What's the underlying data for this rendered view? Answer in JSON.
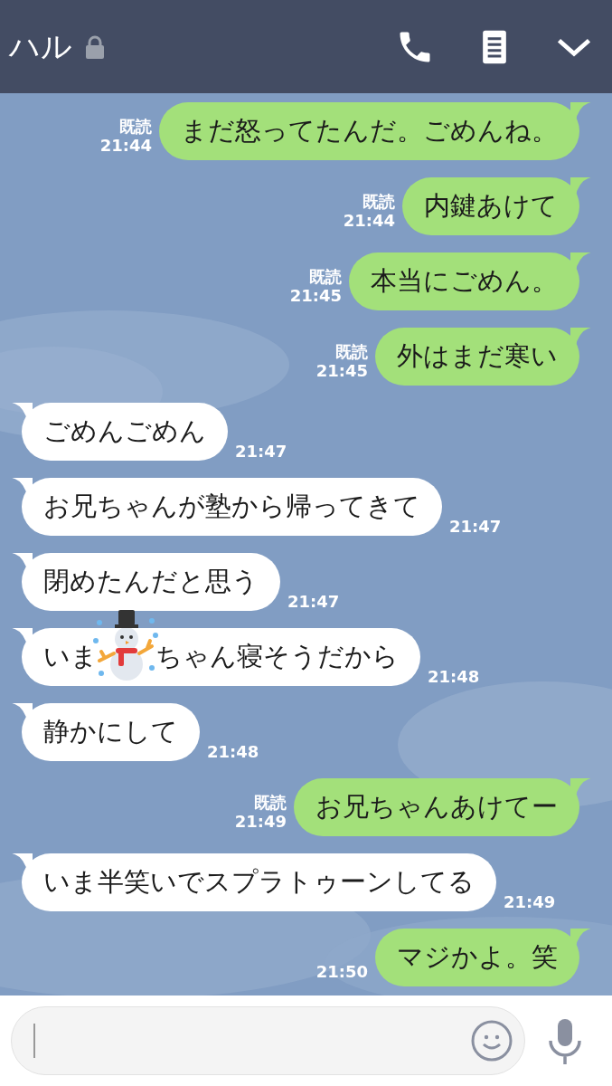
{
  "header": {
    "title": "ハル",
    "locked": true
  },
  "messages": [
    {
      "kind": "sent",
      "text": "まだ怒ってたんだ。ごめんね。",
      "read_receipt": "既読",
      "time": "21:44"
    },
    {
      "kind": "sent",
      "text": "内鍵あけて",
      "read_receipt": "既読",
      "time": "21:44"
    },
    {
      "kind": "sent",
      "text": "本当にごめん。",
      "read_receipt": "既読",
      "time": "21:45"
    },
    {
      "kind": "sent",
      "text": "外はまだ寒い",
      "read_receipt": "既読",
      "time": "21:45"
    },
    {
      "kind": "received",
      "text": "ごめんごめん",
      "time": "21:47"
    },
    {
      "kind": "received",
      "text": "お兄ちゃんが塾から帰ってきて",
      "time": "21:47"
    },
    {
      "kind": "received",
      "text": "閉めたんだと思う",
      "time": "21:47"
    },
    {
      "kind": "received",
      "text": "いま",
      "text_after": "ちゃん寝そうだから",
      "sticker": {
        "kind": "snowman"
      },
      "time": "21:48"
    },
    {
      "kind": "received",
      "text": "静かにして",
      "time": "21:48"
    },
    {
      "kind": "sent",
      "text": "お兄ちゃんあけてー",
      "read_receipt": "既読",
      "time": "21:49"
    },
    {
      "kind": "received",
      "text": "いま半笑いでスプラトゥーンしてる",
      "time": "21:49"
    },
    {
      "kind": "sent",
      "text": "マジかよ。笑",
      "time": "21:50"
    }
  ]
}
